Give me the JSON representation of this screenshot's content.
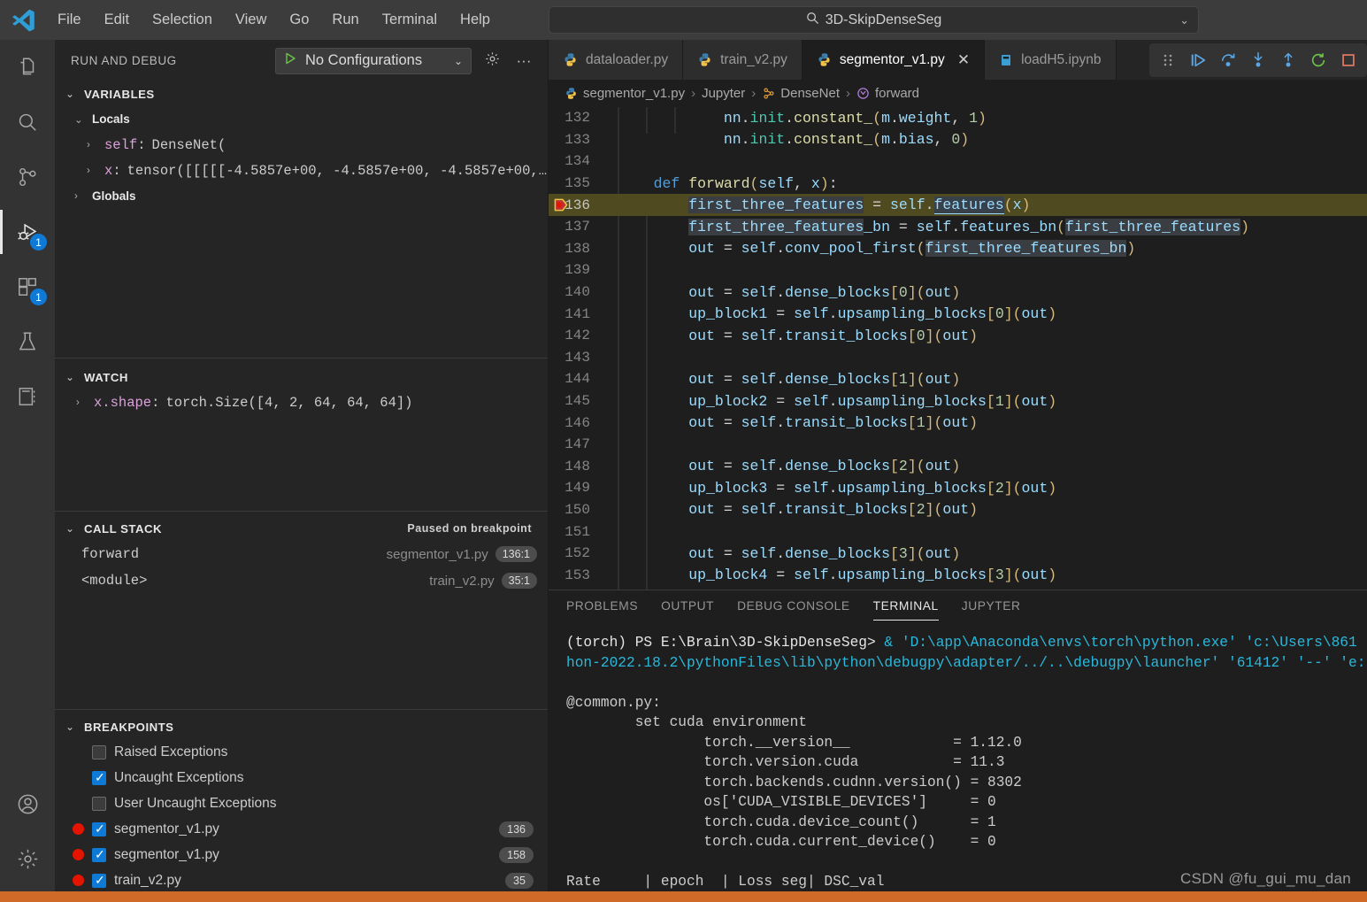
{
  "titlebar": {
    "menus": [
      "File",
      "Edit",
      "Selection",
      "View",
      "Go",
      "Run",
      "Terminal",
      "Help"
    ],
    "back_icon": "arrow-left-icon",
    "forward_icon": "arrow-right-icon",
    "search_value": "3D-SkipDenseSeg",
    "search_icon": "search-icon",
    "chevron": "⌄"
  },
  "activity_bar": {
    "items": [
      {
        "name": "explorer",
        "icon": "files-icon",
        "badge": ""
      },
      {
        "name": "search",
        "icon": "search-icon",
        "badge": ""
      },
      {
        "name": "source-control",
        "icon": "source-control-icon",
        "badge": ""
      },
      {
        "name": "run-and-debug",
        "icon": "debug-icon",
        "badge": "1",
        "active": true
      },
      {
        "name": "extensions",
        "icon": "extensions-icon",
        "badge": "1"
      },
      {
        "name": "testing",
        "icon": "beaker-icon",
        "badge": ""
      },
      {
        "name": "notebook",
        "icon": "notebook-icon",
        "badge": ""
      }
    ],
    "bottom": [
      {
        "name": "accounts",
        "icon": "account-icon"
      },
      {
        "name": "manage",
        "icon": "gear-icon"
      }
    ]
  },
  "sidebar": {
    "title": "RUN AND DEBUG",
    "config_label": "No Configurations",
    "config_play_icon": "play-icon",
    "config_chevron": "⌄",
    "gear_icon": "gear-icon",
    "more_icon": "ellipsis-icon",
    "variables": {
      "title": "VARIABLES",
      "scopes": [
        {
          "label": "Locals",
          "items": [
            {
              "name": "self",
              "value": "DenseNet("
            },
            {
              "name": "x",
              "value": "tensor([[[[[-4.5857e+00, -4.5857e+00, -4.5857e+00,…"
            }
          ]
        },
        {
          "label": "Globals",
          "items": []
        }
      ]
    },
    "watch": {
      "title": "WATCH",
      "items": [
        {
          "name": "x.shape",
          "value": "torch.Size([4, 2, 64, 64, 64])"
        }
      ]
    },
    "call_stack": {
      "title": "CALL STACK",
      "status": "Paused on breakpoint",
      "frames": [
        {
          "name": "forward",
          "file": "segmentor_v1.py",
          "pos": "136:1"
        },
        {
          "name": "<module>",
          "file": "train_v2.py",
          "pos": "35:1"
        }
      ]
    },
    "breakpoints": {
      "title": "BREAKPOINTS",
      "items": [
        {
          "label": "Raised Exceptions",
          "checked": false,
          "dot": false,
          "line": ""
        },
        {
          "label": "Uncaught Exceptions",
          "checked": true,
          "dot": false,
          "line": ""
        },
        {
          "label": "User Uncaught Exceptions",
          "checked": false,
          "dot": false,
          "line": ""
        },
        {
          "label": "segmentor_v1.py",
          "checked": true,
          "dot": true,
          "line": "136"
        },
        {
          "label": "segmentor_v1.py",
          "checked": true,
          "dot": true,
          "line": "158"
        },
        {
          "label": "train_v2.py",
          "checked": true,
          "dot": true,
          "line": "35"
        }
      ]
    }
  },
  "editor": {
    "tabs": [
      {
        "label": "dataloader.py",
        "icon": "python-icon",
        "active": false,
        "closable": false
      },
      {
        "label": "train_v2.py",
        "icon": "python-icon",
        "active": false,
        "closable": false
      },
      {
        "label": "segmentor_v1.py",
        "icon": "python-icon",
        "active": true,
        "closable": true,
        "close": "✕"
      },
      {
        "label": "loadH5.ipynb",
        "icon": "notebook-icon",
        "active": false,
        "closable": false
      }
    ],
    "debug_toolbar": [
      {
        "name": "drag-handle-icon"
      },
      {
        "name": "continue-icon"
      },
      {
        "name": "step-over-icon"
      },
      {
        "name": "step-into-icon"
      },
      {
        "name": "step-out-icon"
      },
      {
        "name": "restart-icon"
      },
      {
        "name": "stop-icon"
      }
    ],
    "breadcrumb": [
      {
        "label": "segmentor_v1.py",
        "icon": "python-icon"
      },
      {
        "label": "Jupyter",
        "icon": ""
      },
      {
        "label": "DenseNet",
        "icon": "class-icon"
      },
      {
        "label": "forward",
        "icon": "method-icon"
      }
    ],
    "breadcrumb_sep": "›",
    "current_line": 136,
    "code_lines": [
      {
        "n": 132,
        "text": "            nn.init.constant_(m.weight, 1)"
      },
      {
        "n": 133,
        "text": "            nn.init.constant_(m.bias, 0)"
      },
      {
        "n": 134,
        "text": ""
      },
      {
        "n": 135,
        "text": "    def forward(self, x):"
      },
      {
        "n": 136,
        "text": "        first_three_features = self.features(x)"
      },
      {
        "n": 137,
        "text": "        first_three_features_bn = self.features_bn(first_three_features)"
      },
      {
        "n": 138,
        "text": "        out = self.conv_pool_first(first_three_features_bn)"
      },
      {
        "n": 139,
        "text": ""
      },
      {
        "n": 140,
        "text": "        out = self.dense_blocks[0](out)"
      },
      {
        "n": 141,
        "text": "        up_block1 = self.upsampling_blocks[0](out)"
      },
      {
        "n": 142,
        "text": "        out = self.transit_blocks[0](out)"
      },
      {
        "n": 143,
        "text": ""
      },
      {
        "n": 144,
        "text": "        out = self.dense_blocks[1](out)"
      },
      {
        "n": 145,
        "text": "        up_block2 = self.upsampling_blocks[1](out)"
      },
      {
        "n": 146,
        "text": "        out = self.transit_blocks[1](out)"
      },
      {
        "n": 147,
        "text": ""
      },
      {
        "n": 148,
        "text": "        out = self.dense_blocks[2](out)"
      },
      {
        "n": 149,
        "text": "        up_block3 = self.upsampling_blocks[2](out)"
      },
      {
        "n": 150,
        "text": "        out = self.transit_blocks[2](out)"
      },
      {
        "n": 151,
        "text": ""
      },
      {
        "n": 152,
        "text": "        out = self.dense_blocks[3](out)"
      },
      {
        "n": 153,
        "text": "        up_block4 = self.upsampling_blocks[3](out)"
      }
    ]
  },
  "panel": {
    "tabs": [
      "PROBLEMS",
      "OUTPUT",
      "DEBUG CONSOLE",
      "TERMINAL",
      "JUPYTER"
    ],
    "active_tab": "TERMINAL",
    "terminal": {
      "prompt": "(torch) PS E:\\Brain\\3D-SkipDenseSeg>",
      "cmd_line1": " & 'D:\\app\\Anaconda\\envs\\torch\\python.exe' 'c:\\Users\\861",
      "cmd_line2": "hon-2022.18.2\\pythonFiles\\lib\\python\\debugpy\\adapter/../..\\debugpy\\launcher' '61412' '--' 'e:",
      "block_header": "@common.py:",
      "section": "        set cuda environment",
      "env_rows": [
        {
          "key": "                torch.__version__",
          "pad": "            ",
          "value": "= 1.12.0"
        },
        {
          "key": "                torch.version.cuda",
          "pad": "           ",
          "value": "= 11.3"
        },
        {
          "key": "                torch.backends.cudnn.version()",
          "pad": " ",
          "value": "= 8302"
        },
        {
          "key": "                os['CUDA_VISIBLE_DEVICES']",
          "pad": "     ",
          "value": "= 0"
        },
        {
          "key": "                torch.cuda.device_count()",
          "pad": "      ",
          "value": "= 1"
        },
        {
          "key": "                torch.cuda.current_device()",
          "pad": "    ",
          "value": "= 0"
        }
      ],
      "table_header": "Rate     | epoch  | Loss seg| DSC_val"
    }
  },
  "watermark": "CSDN @fu_gui_mu_dan",
  "colors": {
    "accent_blue": "#0e7ad6",
    "status_bar": "#cf6a28",
    "breakpoint_red": "#e51400",
    "highlight_line": "#4f4a1f",
    "terminal_cyan": "#29b8db"
  }
}
